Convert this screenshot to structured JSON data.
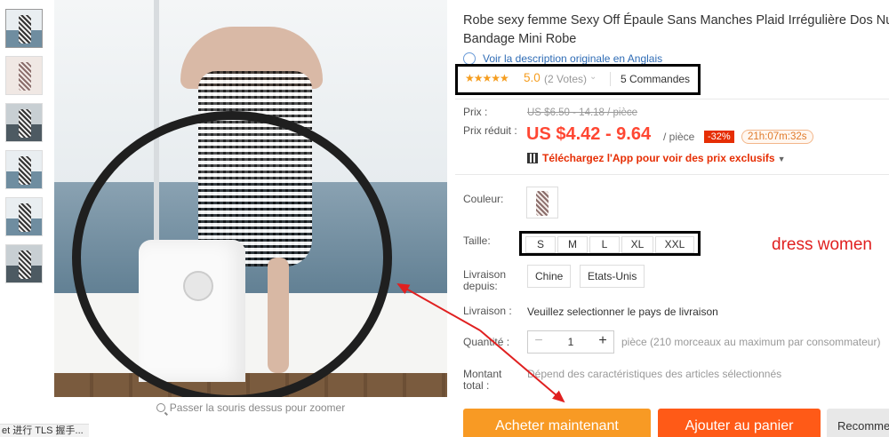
{
  "thumbnails": [
    {
      "name": "thumb-1",
      "style": "sea"
    },
    {
      "name": "thumb-2",
      "style": "alt"
    },
    {
      "name": "thumb-3",
      "style": "dark"
    },
    {
      "name": "thumb-4",
      "style": "sea"
    },
    {
      "name": "thumb-5",
      "style": "sea"
    },
    {
      "name": "thumb-6",
      "style": "dark"
    }
  ],
  "gallery": {
    "zoom_hint": "Passer la souris dessus pour zoomer"
  },
  "status_bar": {
    "text": "et 进行 TLS 握手..."
  },
  "product": {
    "title_line1": "Robe sexy femme Sexy Off Épaule Sans Manches Plaid Irrégulière Dos Nu",
    "title_line2": "Bandage Mini Robe",
    "original_link": "Voir la description originale en Anglais"
  },
  "rating": {
    "stars": "★★★★★",
    "score": "5.0",
    "votes": "(2 Votes)",
    "orders": "5 Commandes"
  },
  "pricing": {
    "price_label": "Prix :",
    "price_old": "US $6.50 - 14.18 / pièce",
    "reduced_label": "Prix réduit :",
    "price_main": "US $4.42 - 9.64",
    "per_piece": "/ pièce",
    "discount": "-32%",
    "timer": "21h:07m:32s",
    "app_promo": "Téléchargez l'App pour voir des prix exclusifs"
  },
  "options": {
    "color_label": "Couleur:",
    "size_label": "Taille:",
    "sizes": [
      "S",
      "M",
      "L",
      "XL",
      "XXL"
    ],
    "ship_from_label": "Livraison depuis:",
    "ship_from": [
      "Chine",
      "Etats-Unis"
    ],
    "shipping_label": "Livraison :",
    "shipping_msg": "Veuillez selectionner le pays de livraison",
    "quantity_label": "Quantité :",
    "quantity": "1",
    "quantity_note": "pièce (210 morceaux au maximum par consommateur)",
    "total_label": "Montant total :",
    "total_note": "Dépend des caractéristiques des articles sélectionnés"
  },
  "annotation": {
    "text": "dress women",
    "color": "#e02020"
  },
  "actions": {
    "buy_now": "Acheter maintenant",
    "add_cart": "Ajouter au panier",
    "recommend": "Recomme"
  },
  "colors": {
    "price": "#ff4733",
    "buy_button": "#f89a24",
    "cart_button": "#ff5a17",
    "star": "#f59d1f",
    "link": "#2f6cb5"
  }
}
